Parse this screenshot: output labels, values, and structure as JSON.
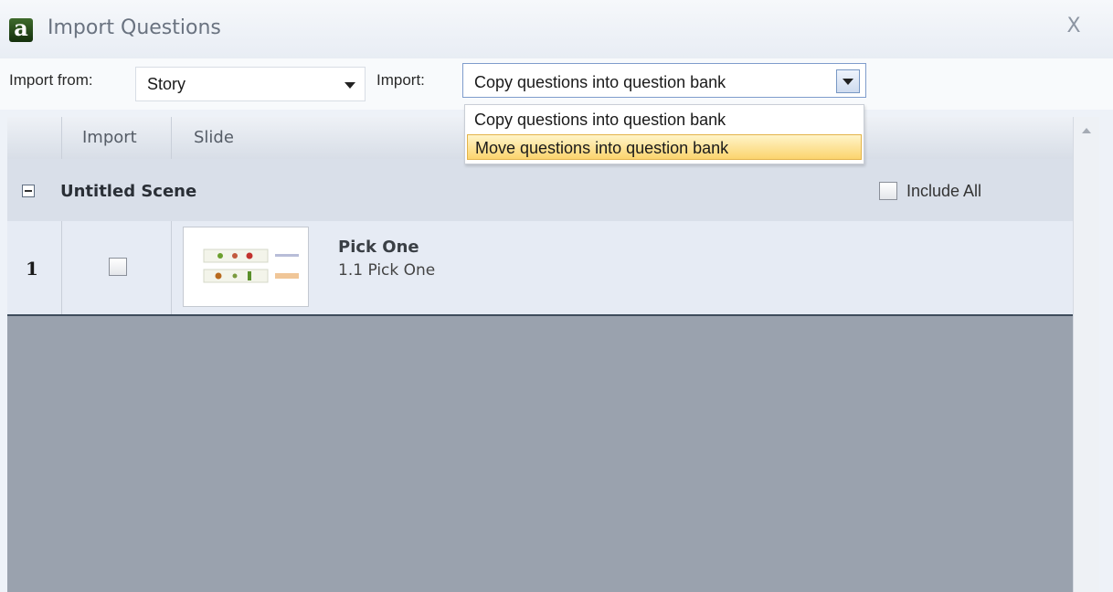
{
  "window": {
    "title": "Import Questions",
    "close_label": "X"
  },
  "toolbar": {
    "import_from_label": "Import from:",
    "import_from_value": "Story",
    "import_label": "Import:",
    "import_value": "Copy questions into question bank"
  },
  "dropdown": {
    "options": [
      "Copy questions into question bank",
      "Move questions into question bank"
    ],
    "highlighted_index": 1
  },
  "grid": {
    "columns": [
      "Import",
      "Slide"
    ],
    "group": {
      "title": "Untitled Scene",
      "include_all_label": "Include All",
      "include_all_checked": false
    },
    "rows": [
      {
        "number": "1",
        "checked": false,
        "slide_title": "Pick One",
        "slide_subtitle": "1.1 Pick One"
      }
    ]
  },
  "colors": {
    "highlight": "#fbd46e",
    "group_bg": "#d9dfe9",
    "empty_area": "#9aa2ae"
  }
}
